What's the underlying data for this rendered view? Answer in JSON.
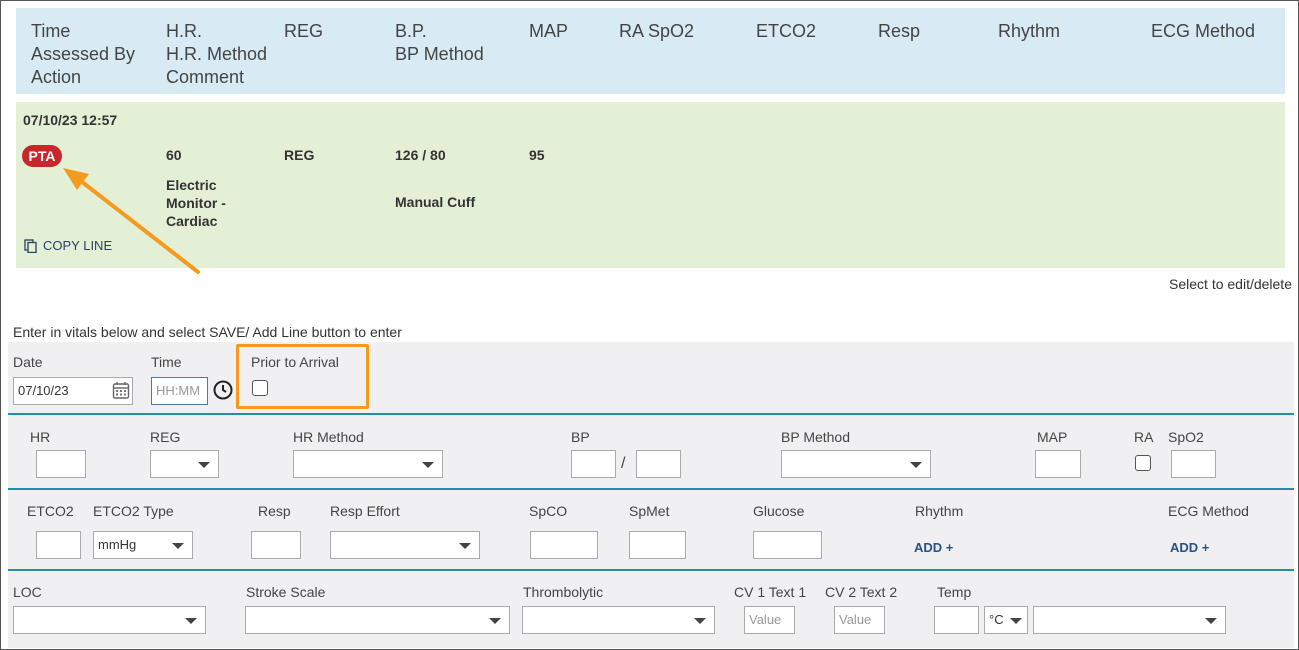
{
  "header": {
    "col1": [
      "Time",
      "Assessed By",
      "Action"
    ],
    "col2": [
      "H.R.",
      "H.R. Method",
      "Comment"
    ],
    "reg": "REG",
    "bp": [
      "B.P.",
      "BP Method"
    ],
    "map": "MAP",
    "ra_spo2": "RA SpO2",
    "etco2": "ETCO2",
    "resp": "Resp",
    "rhythm": "Rhythm",
    "ecg_method": "ECG Method"
  },
  "record": {
    "datetime": "07/10/23 12:57",
    "badge": "PTA",
    "hr": "60",
    "hr_method": [
      "Electric",
      "Monitor -",
      "Cardiac"
    ],
    "reg": "REG",
    "bp": "126 / 80",
    "bp_method": "Manual Cuff",
    "map": "95",
    "copy_line": "COPY LINE"
  },
  "hints": {
    "select_edit": "Select to edit/delete",
    "enter_vitals": "Enter in vitals below and select SAVE/ Add Line button to enter"
  },
  "form": {
    "date_label": "Date",
    "date_value": "07/10/23",
    "time_label": "Time",
    "time_placeholder": "HH:MM",
    "pta_label": "Prior to Arrival",
    "hr": "HR",
    "reg": "REG",
    "hr_method": "HR Method",
    "bp": "BP",
    "bp_sep": "/",
    "bp_method": "BP Method",
    "map": "MAP",
    "ra": "RA",
    "spo2": "SpO2",
    "etco2": "ETCO2",
    "etco2_type": "ETCO2 Type",
    "etco2_type_value": "mmHg",
    "resp": "Resp",
    "resp_effort": "Resp Effort",
    "spco": "SpCO",
    "spmet": "SpMet",
    "glucose": "Glucose",
    "rhythm": "Rhythm",
    "ecg_method": "ECG Method",
    "add_label": "ADD +",
    "loc": "LOC",
    "stroke_scale": "Stroke Scale",
    "thrombolytic": "Thrombolytic",
    "cv1": "CV 1 Text 1",
    "cv2": "CV 2 Text 2",
    "value_placeholder": "Value",
    "temp": "Temp",
    "temp_unit": "°C"
  },
  "colors": {
    "header_bg": "#d8ebf4",
    "row_bg": "#e3f0d6",
    "badge": "#c9262c",
    "annotation": "#f39a1f",
    "divider": "#1f8fa3"
  }
}
